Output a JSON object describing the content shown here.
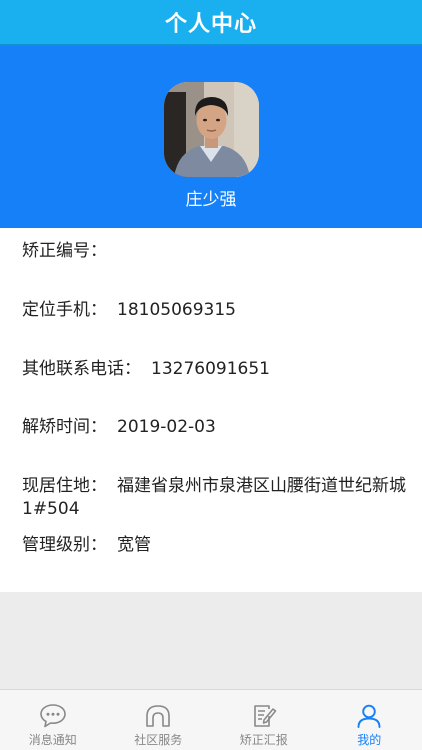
{
  "header": {
    "title": "个人中心"
  },
  "profile": {
    "name": "庄少强"
  },
  "info": [
    {
      "label": "矫正编号：",
      "value": ""
    },
    {
      "label": "定位手机：",
      "value": "18105069315"
    },
    {
      "label": "其他联系电话：",
      "value": "13276091651"
    },
    {
      "label": "解矫时间：",
      "value": "2019-02-03"
    },
    {
      "label": "现居住地：",
      "value": "福建省泉州市泉港区山腰街道世纪新城1#504"
    },
    {
      "label": "管理级别：",
      "value": "宽管"
    }
  ],
  "tabs": [
    {
      "label": "消息通知",
      "icon": "message-icon",
      "active": false
    },
    {
      "label": "社区服务",
      "icon": "community-icon",
      "active": false
    },
    {
      "label": "矫正汇报",
      "icon": "report-icon",
      "active": false
    },
    {
      "label": "我的",
      "icon": "user-icon",
      "active": true
    }
  ],
  "colors": {
    "title_bar": "#1ab0f0",
    "profile_bg": "#1580f8",
    "tab_active": "#1580f8",
    "tab_inactive": "#888888"
  }
}
